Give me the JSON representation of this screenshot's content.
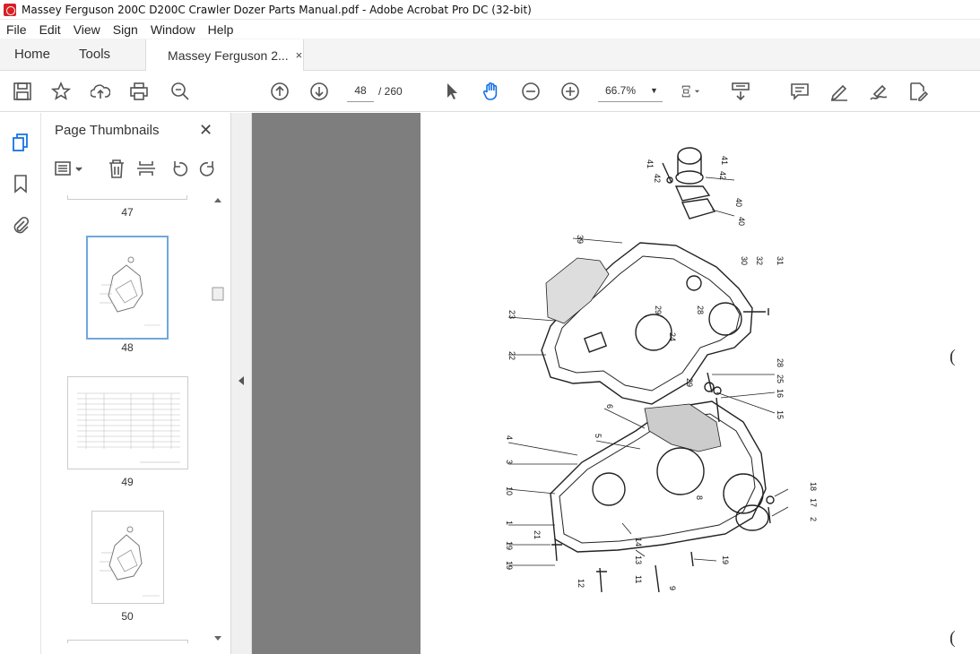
{
  "window": {
    "title": "Massey Ferguson 200C D200C Crawler Dozer Parts Manual.pdf - Adobe Acrobat Pro DC (32-bit)"
  },
  "menu": [
    "File",
    "Edit",
    "View",
    "Sign",
    "Window",
    "Help"
  ],
  "tabs": {
    "home": "Home",
    "tools": "Tools",
    "document": "Massey Ferguson 2...",
    "close": "×"
  },
  "toolbar": {
    "current_page": "48",
    "total_pages": "/ 260",
    "zoom": "66.7%",
    "icons": [
      "save-icon",
      "bookmark-star-icon",
      "upload-icon",
      "print-icon",
      "search-zoom-icon",
      "page-up-icon",
      "page-down-icon",
      "select-cursor-icon",
      "hand-icon",
      "zoom-out-icon",
      "zoom-in-icon",
      "fit-page-icon",
      "scroll-mode-icon",
      "comment-icon",
      "highlight-icon",
      "sign-icon",
      "edit-pdf-icon"
    ]
  },
  "sidebar": {
    "title": "Page Thumbnails",
    "close": "✕",
    "thumbnails": [
      {
        "label": "47",
        "selected": false
      },
      {
        "label": "48",
        "selected": true
      },
      {
        "label": "49",
        "selected": false
      },
      {
        "label": "50",
        "selected": false
      }
    ]
  },
  "diagram_callouts": [
    "1",
    "2",
    "3",
    "4",
    "5",
    "6",
    "7",
    "8",
    "9",
    "10",
    "11",
    "12",
    "13",
    "14",
    "15",
    "16",
    "17",
    "18",
    "19",
    "21",
    "22",
    "23",
    "24",
    "25",
    "26",
    "27",
    "28",
    "29",
    "30",
    "31",
    "32",
    "36",
    "37",
    "38",
    "39",
    "40",
    "41",
    "42"
  ],
  "colors": {
    "accent": "#1473e6",
    "viewer_bg": "#7e7e7e",
    "selected_thumb_border": "#6fa8dc"
  }
}
